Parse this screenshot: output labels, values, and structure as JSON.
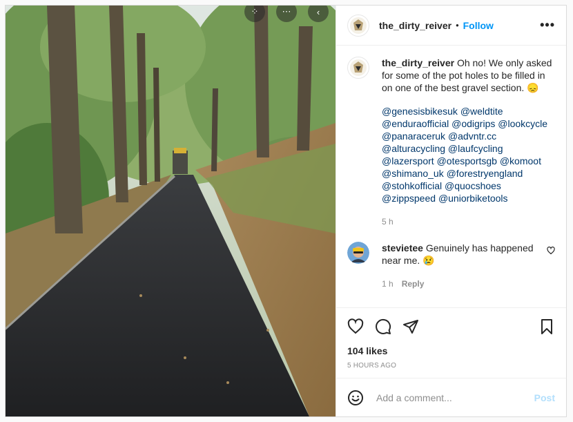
{
  "post": {
    "username": "the_dirty_reiver",
    "follow_label": "Follow",
    "separator": "•",
    "more_label": "•••",
    "caption_text": "Oh no! We only asked for some of the pot holes to be filled in on one of the best gravel section. 😞",
    "tags": [
      "@genesisbikesuk",
      "@weldtite",
      "@enduraofficial",
      "@odigrips",
      "@lookcycle",
      "@panaraceruk",
      "@advntr.cc",
      "@alturacycling",
      "@laufcycling",
      "@lazersport",
      "@otesportsgb",
      "@komoot",
      "@shimano_uk",
      "@forestryengland",
      "@stohkofficial",
      "@quocshoes",
      "@zippspeed",
      "@uniorbiketools"
    ],
    "caption_time": "5 h"
  },
  "comment": {
    "username": "stevietee",
    "text": "Genuinely has happened near me. 😢",
    "time": "1 h",
    "reply_label": "Reply"
  },
  "stats": {
    "likes": "104 likes",
    "posted_ago": "5 HOURS AGO"
  },
  "composer": {
    "placeholder": "Add a comment...",
    "post_label": "Post"
  },
  "icons": {
    "like": "heart-icon",
    "comment": "comment-icon",
    "share": "paper-plane-icon",
    "save": "bookmark-icon",
    "emoji": "smiley-icon"
  },
  "colors": {
    "accent": "#0095f6",
    "post_disabled": "#b2dffc",
    "mention": "#00376b",
    "muted": "#8e8e8e"
  }
}
